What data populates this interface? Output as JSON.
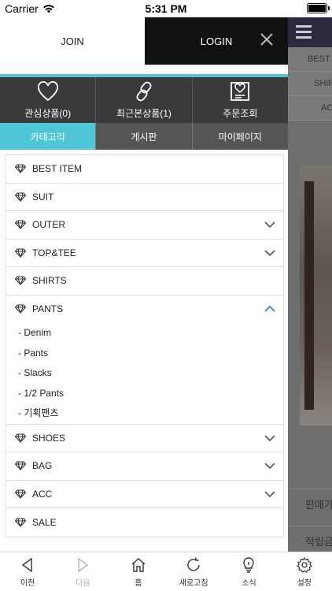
{
  "status": {
    "carrier": "Carrier",
    "time": "5:31 PM"
  },
  "header": {
    "join": "JOIN",
    "login": "LOGIN"
  },
  "quick": [
    {
      "label": "관심상품(0)",
      "icon": "heart-icon"
    },
    {
      "label": "최근본상품(1)",
      "icon": "link-icon"
    },
    {
      "label": "주문조회",
      "icon": "order-icon"
    }
  ],
  "tabs": [
    {
      "label": "카테고리",
      "active": true
    },
    {
      "label": "게시판",
      "active": false
    },
    {
      "label": "마이페이지",
      "active": false
    }
  ],
  "categories": [
    {
      "label": "BEST ITEM",
      "chevron": "none"
    },
    {
      "label": "SUIT",
      "chevron": "none"
    },
    {
      "label": "OUTER",
      "chevron": "down"
    },
    {
      "label": "TOP&TEE",
      "chevron": "down"
    },
    {
      "label": "SHIRTS",
      "chevron": "none"
    },
    {
      "label": "PANTS",
      "chevron": "up"
    },
    {
      "label": "SHOES",
      "chevron": "down"
    },
    {
      "label": "BAG",
      "chevron": "down"
    },
    {
      "label": "ACC",
      "chevron": "down"
    },
    {
      "label": "SALE",
      "chevron": "none"
    }
  ],
  "pants_sub": [
    "- Denim",
    "- Pants",
    "- Slacks",
    "- 1/2 Pants",
    "- 기획팬츠"
  ],
  "background": {
    "strips": [
      "BEST",
      "SHIF",
      "AC"
    ],
    "rows": [
      "판매가",
      "적립금"
    ]
  },
  "toolbar": [
    {
      "label": "이전",
      "icon": "back-icon",
      "enabled": true
    },
    {
      "label": "다음",
      "icon": "forward-icon",
      "enabled": false
    },
    {
      "label": "홈",
      "icon": "home-icon",
      "enabled": true
    },
    {
      "label": "새로고침",
      "icon": "refresh-icon",
      "enabled": true
    },
    {
      "label": "소식",
      "icon": "bulb-icon",
      "enabled": true
    },
    {
      "label": "설정",
      "icon": "gear-icon",
      "enabled": true
    }
  ],
  "colors": {
    "accent": "#4fc6d8",
    "dark": "#3a3a3a",
    "tab": "#555555",
    "login_bg": "#111111"
  }
}
